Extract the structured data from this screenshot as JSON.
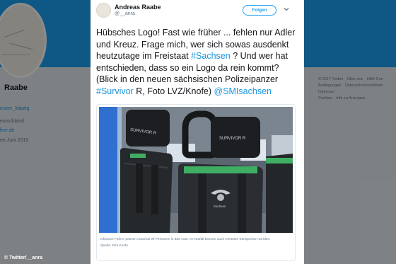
{
  "background": {
    "profile_name": "Raabe",
    "handle_link": "euzer_leipzig",
    "location": "eutschland",
    "url": "line.de",
    "joined": "en Juni 2015",
    "footer_links": [
      "© 2017 Twitter",
      "Über uns",
      "Hilfe-Cen",
      "Bedingungen",
      "Datenschutzrichtlinien",
      "Impressu",
      "Cookies",
      "Info zu Anzeigen"
    ]
  },
  "credit": "© Twitter/__anra",
  "tweet": {
    "author_name": "Andreas Raabe",
    "author_handle": "@__anra",
    "follow_label": "Folgen",
    "text_part1": "Hübsches Logo! Fast wie früher ... fehlen nur Adler und Kreuz. Frage mich, wer sich sowas ausdenkt heutzutage im Freistaat ",
    "hashtag_sachsen": "#Sachsen",
    "text_part2": " ? Und wer hat entschieden, dass so ein Logo da rein kommt? (Blick in den neuen sächsischen Polizeipanzer ",
    "hashtag_survivor": "#Survivor",
    "text_part3": " R, Foto LVZ/Knofe) ",
    "mention": "@SMIsachsen",
    "media_caption": "Inklusive Fahrer passen maximal elf Personen in das Auto. Im Notfall können auch Verletzte transportiert werden.",
    "media_source": "Quelle: Dirk Knofe",
    "seat_logo_text": "SURVIVOR R",
    "seat_emblem_text": "Sachsen"
  },
  "colors": {
    "twitter_blue": "#1da1f2",
    "link_blue": "#1b95e0",
    "strap_green": "#3fae63"
  }
}
